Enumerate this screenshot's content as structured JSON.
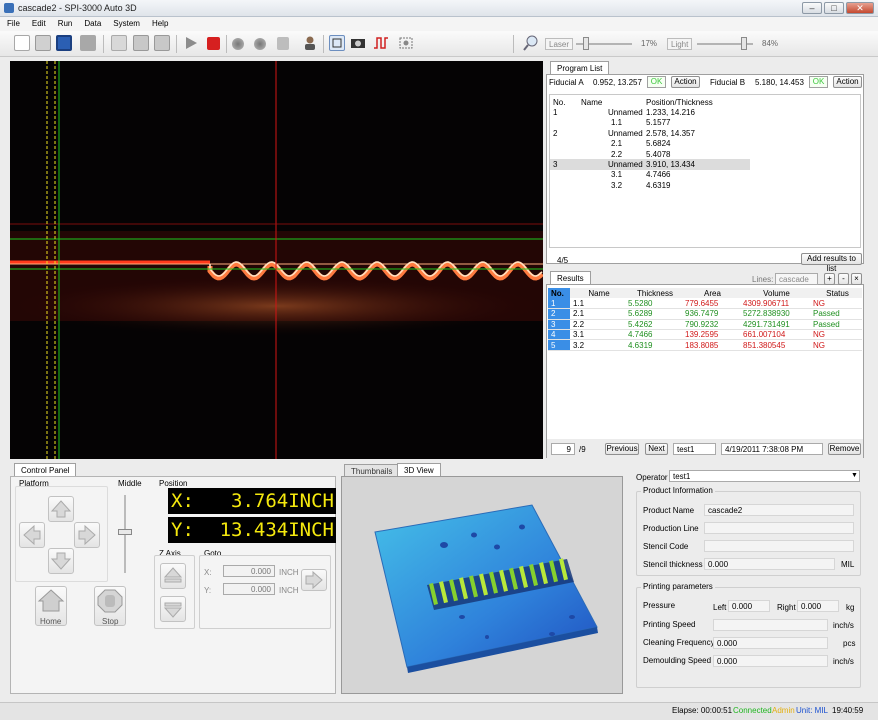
{
  "window": {
    "title": "cascade2 - SPI-3000 Auto 3D"
  },
  "menu": [
    "File",
    "Edit",
    "Run",
    "Data",
    "System",
    "Help"
  ],
  "toolbar": {
    "icons": [
      "new-file-icon",
      "open-icon",
      "save-icon",
      "import-icon",
      "edit-icon",
      "grid-icon",
      "grid2-icon",
      "play-icon",
      "stop-icon",
      "record-icon",
      "record2-icon",
      "record3-icon",
      "operator-icon",
      "view-mode-icon",
      "camera-icon",
      "pulse-icon",
      "screenshot-icon",
      "zoom-icon"
    ],
    "laser": {
      "label": "Laser",
      "percent": "17%",
      "level": 0.17
    },
    "light": {
      "label": "Light",
      "percent": "84%",
      "level": 0.84
    }
  },
  "program_list": {
    "tab": "Program List",
    "fiducial_a": {
      "label": "Fiducial A",
      "value": "0.952, 13.257",
      "ok": "OK",
      "action": "Action"
    },
    "fiducial_b": {
      "label": "Fiducial B",
      "value": "5.180, 14.453",
      "ok": "OK",
      "action": "Action"
    },
    "columns": [
      "No.",
      "Name",
      "Position/Thickness"
    ],
    "rows": [
      {
        "no": "1",
        "name": "Unnamed",
        "value": "1.233, 14.216"
      },
      {
        "no": "",
        "name": "1.1",
        "value": "5.1577"
      },
      {
        "no": "2",
        "name": "Unnamed",
        "value": "2.578, 14.357"
      },
      {
        "no": "",
        "name": "2.1",
        "value": "5.6824"
      },
      {
        "no": "",
        "name": "2.2",
        "value": "5.4078"
      },
      {
        "no": "3",
        "name": "Unnamed",
        "value": "3.910, 13.434"
      },
      {
        "no": "",
        "name": "3.1",
        "value": "4.7466"
      },
      {
        "no": "",
        "name": "3.2",
        "value": "4.6319"
      }
    ],
    "counter": "4/5",
    "add_results": "Add results to list"
  },
  "results": {
    "tab": "Results",
    "lines_label": "Lines:",
    "lines_value": "cascade",
    "columns": [
      "No.",
      "Name",
      "Thickness",
      "Area",
      "Volume",
      "Status"
    ],
    "rows": [
      {
        "no": "1",
        "name": "1.1",
        "thickness": "5.5280",
        "area": "779.6455",
        "volume": "4309.906711",
        "status": "NG"
      },
      {
        "no": "2",
        "name": "2.1",
        "thickness": "5.6289",
        "area": "936.7479",
        "volume": "5272.838930",
        "status": "Passed"
      },
      {
        "no": "3",
        "name": "2.2",
        "thickness": "5.4262",
        "area": "790.9232",
        "volume": "4291.731491",
        "status": "Passed"
      },
      {
        "no": "4",
        "name": "3.1",
        "thickness": "4.7466",
        "area": "139.2595",
        "volume": "661.007104",
        "status": "NG"
      },
      {
        "no": "5",
        "name": "3.2",
        "thickness": "4.6319",
        "area": "183.8085",
        "volume": "851.380545",
        "status": "NG"
      }
    ],
    "page": "9",
    "page_total": "/9",
    "previous": "Previous",
    "next": "Next",
    "name_value": "test1",
    "date_value": "4/19/2011 7:38:08 PM",
    "remove": "Remove"
  },
  "control_panel": {
    "tab": "Control Panel",
    "platform": "Platform",
    "middle": "Middle",
    "position": "Position",
    "x_label": "X:",
    "x_value": "3.764INCH",
    "y_label": "Y:",
    "y_value": "13.434INCH",
    "z_axis": "Z Axis",
    "goto": "Goto",
    "goto_x_label": "X:",
    "goto_x": "0.000",
    "goto_y_label": "Y:",
    "goto_y": "0.000",
    "unit": "INCH",
    "home": "Home",
    "stop": "Stop"
  },
  "viewer": {
    "tabs": [
      "Thumbnails",
      "3D View"
    ]
  },
  "operator": {
    "label": "Operator",
    "value": "test1"
  },
  "product_info": {
    "title": "Product Information",
    "product_name_label": "Product Name",
    "product_name": "cascade2",
    "production_line_label": "Production Line",
    "production_line": "",
    "stencil_code_label": "Stencil Code",
    "stencil_code": "",
    "stencil_thickness_label": "Stencil thickness",
    "stencil_thickness": "0.000",
    "stencil_unit": "MIL"
  },
  "printing": {
    "title": "Printing parameters",
    "pressure_label": "Pressure",
    "left_label": "Left",
    "left": "0.000",
    "right_label": "Right",
    "right": "0.000",
    "pressure_unit": "kg",
    "speed_label": "Printing Speed",
    "speed": "",
    "speed_unit": "inch/s",
    "cleaning_label": "Cleaning Frequency",
    "cleaning": "0.000",
    "cleaning_unit": "pcs",
    "demould_label": "Demoulding Speed",
    "demould": "0.000",
    "demould_unit": "inch/s"
  },
  "status": {
    "elapse": "Elapse: 00:00:51",
    "connected": "Connected",
    "admin": "Admin",
    "unit": "Unit: MIL",
    "time": "19:40:59"
  },
  "colors": {
    "ng": "#d01818",
    "passed": "#1e8f1e",
    "position_text": "#f5e90e",
    "selected_no": "#3a8ee6"
  }
}
